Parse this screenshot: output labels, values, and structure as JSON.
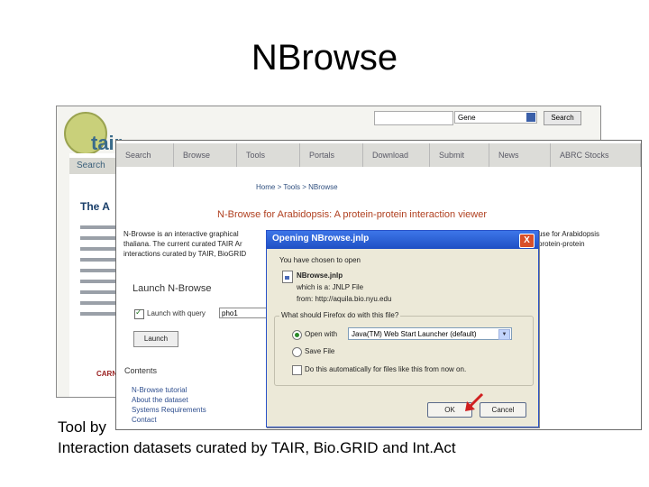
{
  "slide": {
    "title": "NBrowse",
    "caption_line1": "Tool by",
    "caption_line2": "Interaction datasets curated by TAIR, Bio.GRID and Int.Act"
  },
  "tair_page": {
    "logo_text": "tair",
    "gene_select": "Gene",
    "search_button": "Search",
    "nav_search": "Search",
    "heading": "The A",
    "footer_logo": "CARNEGIE"
  },
  "nbrowse_window": {
    "nav_items": [
      "Search",
      "Browse",
      "Tools",
      "Portals",
      "Download",
      "Submit",
      "News",
      "ABRC Stocks"
    ],
    "breadcrumb": "Home > Tools > NBrowse",
    "page_title": "N-Browse for Arabidopsis: A protein-protein interaction viewer",
    "desc_line1": "N-Browse is an interactive graphical",
    "desc_line2": "thaliana. The current curated TAIR Ar",
    "desc_line3": "interactions curated by TAIR, BioGRID",
    "desc_right1": "use for Arabidopsis",
    "desc_right2": "protein-protein",
    "launch_title": "Launch N-Browse",
    "launch_check_label": "Launch with query",
    "query_value": "pho1",
    "launch_button": "Launch",
    "contents_title": "Contents",
    "links": [
      "N-Browse tutorial",
      "About the dataset",
      "Systems Requirements",
      "Contact"
    ]
  },
  "dialog": {
    "title": "Opening NBrowse.jnlp",
    "intro": "You have chosen to open",
    "file_name": "NBrowse.jnlp",
    "which_is": "which is a: JNLP File",
    "from": "from: http://aquila.bio.nyu.edu",
    "group_label": "What should Firefox do with this file?",
    "open_with_label": "Open with",
    "open_with_value": "Java(TM) Web Start Launcher (default)",
    "save_label": "Save File",
    "auto_label": "Do this automatically for files like this from now on.",
    "ok_label": "OK",
    "cancel_label": "Cancel",
    "close_glyph": "X"
  },
  "colors": {
    "dialog_title": "#2a5fd8",
    "link": "#2f4f8f",
    "page_title": "#b04020",
    "arrow": "#d02020"
  }
}
